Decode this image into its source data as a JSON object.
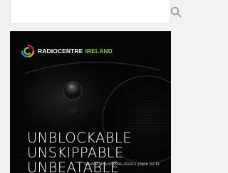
{
  "search": {
    "value": "",
    "placeholder": "",
    "icon": "search-icon"
  },
  "ad": {
    "logo": {
      "word1": "RADIOCENTRE",
      "word2": "IRELAND",
      "accent_color": "#8cc63f"
    },
    "headline": [
      "UNBLOCKABLE",
      "UNSKIPPABLE",
      "UNBEATABLE"
    ],
    "source": "Source: JNLR/Ipsos 2023-1 (April '22 to"
  }
}
